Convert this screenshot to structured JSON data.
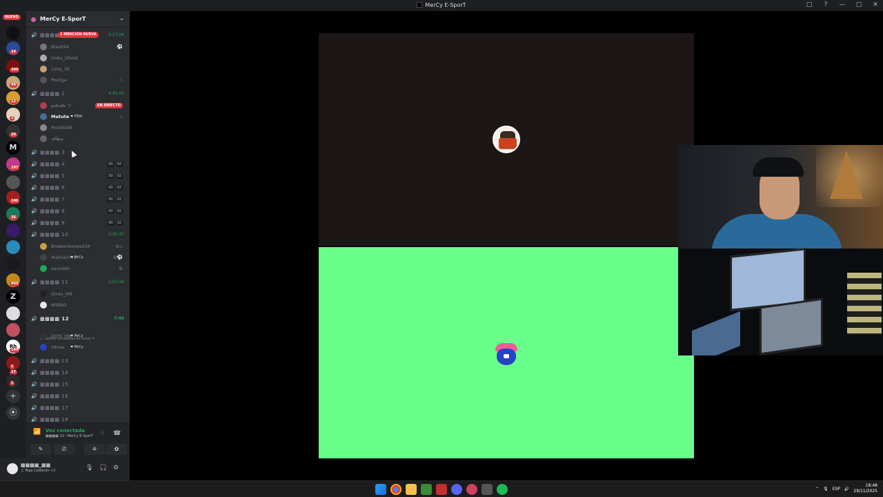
{
  "window": {
    "title": "MerCy E-SporT",
    "controls": [
      "□",
      "?",
      "—",
      "▢",
      "✕"
    ]
  },
  "guildbar": {
    "nuevo": "NUEVO",
    "badges": [
      "14",
      "309",
      "49",
      "12",
      "1",
      "20",
      "297",
      "146",
      "36",
      "969",
      "144",
      "1",
      "17",
      "1"
    ],
    "icons": {
      "add": "+",
      "discover": "⦿"
    }
  },
  "server": {
    "name": "MerCy E-SporT",
    "chevron": "⌄"
  },
  "channels": [
    {
      "name": "▩▩▩▩",
      "time": "2:17:04",
      "pill": "1 MENCIÓN NUEVA"
    },
    {
      "name": "▩▩▩▩ 2",
      "time": "4:41:03"
    },
    {
      "name": "▩▩▩▩ 3"
    },
    {
      "name": "▩▩▩▩ 4",
      "counts": [
        "00",
        "02"
      ]
    },
    {
      "name": "▩▩▩▩ 5",
      "counts": [
        "00",
        "02"
      ]
    },
    {
      "name": "▩▩▩▩ 6",
      "counts": [
        "00",
        "02"
      ]
    },
    {
      "name": "▩▩▩▩ 7",
      "counts": [
        "00",
        "02"
      ]
    },
    {
      "name": "▩▩▩▩ 8",
      "counts": [
        "00",
        "02"
      ]
    },
    {
      "name": "▩▩▩▩ 9",
      "counts": [
        "00",
        "02"
      ]
    },
    {
      "name": "▩▩▩▩ 10",
      "time": "1:35:47"
    },
    {
      "name": "▩▩▩▩ 11",
      "time": "1:02:56"
    },
    {
      "name": "▩▩▩▩ 12",
      "time": "7:46",
      "status": "Establece un estado de canal ✎"
    },
    {
      "name": "▩▩▩▩ 13"
    },
    {
      "name": "▩▩▩▩ 14"
    },
    {
      "name": "▩▩▩▩ 15"
    },
    {
      "name": "▩▩▩▩ 16"
    },
    {
      "name": "▩▩▩▩ 17"
    },
    {
      "name": "▩▩▩▩ 18"
    }
  ],
  "users": {
    "ch1": [
      {
        "name": "Black94"
      },
      {
        "name": "Goku_Ghost"
      },
      {
        "name": "Lizzy_Gt"
      },
      {
        "name": "Pocilga"
      }
    ],
    "ch2": [
      {
        "name": "𝔃𝓮𝓫𝓻𝓲𝓽𝓪 ツ",
        "live": "EN DIRECTO"
      },
      {
        "name": "Matute",
        "tag": "❤ FEIN"
      },
      {
        "name": "Portillo99"
      },
      {
        "name": "𝓐𝓵𝔂𝓼𝓼"
      }
    ],
    "ch10": [
      {
        "name": "Brokembones504"
      },
      {
        "name": "Makhachev",
        "tag": "❤ MrCy"
      },
      {
        "name": "saucedo"
      }
    ],
    "ch11": [
      {
        "name": "Giron_HN"
      },
      {
        "name": "WIRRO"
      }
    ],
    "ch12": [
      {
        "name": "DIOS_HN",
        "tag": "❤ MrCy"
      },
      {
        "name": "z9nae",
        "tag": "❤ MrCy"
      }
    ]
  },
  "voice": {
    "title": "Voz conectada",
    "subtitle": "▩▩▩▩ 12 / MerCy E-SporT",
    "buttons": [
      "✎",
      "⎚",
      "⁜",
      "✿"
    ]
  },
  "user": {
    "name": "▩▩▩▩_▩▩",
    "sub": "♫ Tego Calderón +1",
    "icons": [
      "🎙",
      "🎧",
      "⚙"
    ]
  },
  "taskbar": {
    "lang": "ESP",
    "time": "18:48",
    "date": "29/11/2025"
  },
  "colors": {
    "accent_green": "#23a55a",
    "live_red": "#da373c",
    "tile_green": "#69ff8b",
    "tile_dark": "#1d1616"
  }
}
